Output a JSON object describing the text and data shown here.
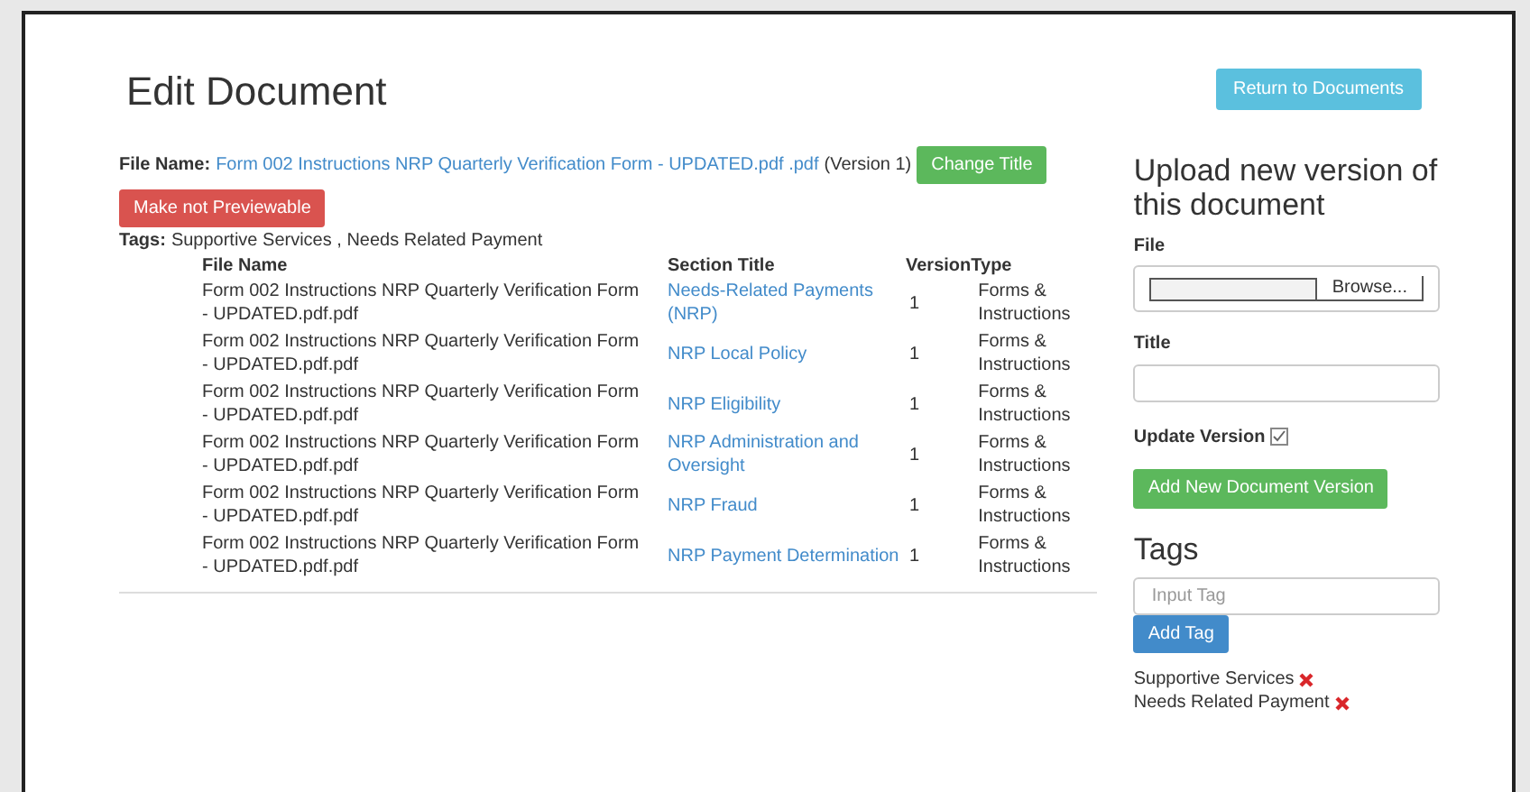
{
  "page_title": "Edit Document",
  "return_button": "Return to Documents",
  "file_name": {
    "label": "File Name:",
    "value": "Form 002 Instructions NRP Quarterly Verification Form - UPDATED.pdf .pdf",
    "version": "(Version 1)",
    "change_button": "Change Title"
  },
  "preview_button": "Make not Previewable",
  "tags_line": {
    "label": "Tags:",
    "value": "Supportive Services , Needs Related Payment"
  },
  "table": {
    "columns": [
      "File Name",
      "Section Title",
      "Version",
      "Type"
    ],
    "rows": [
      {
        "file_name": "Form 002 Instructions NRP Quarterly Verification Form - UPDATED.pdf.pdf",
        "section_title": "Needs-Related Payments (NRP)",
        "version": "1",
        "type": "Forms & Instructions"
      },
      {
        "file_name": "Form 002 Instructions NRP Quarterly Verification Form - UPDATED.pdf.pdf",
        "section_title": "NRP Local Policy",
        "version": "1",
        "type": "Forms & Instructions"
      },
      {
        "file_name": "Form 002 Instructions NRP Quarterly Verification Form - UPDATED.pdf.pdf",
        "section_title": "NRP Eligibility",
        "version": "1",
        "type": "Forms & Instructions"
      },
      {
        "file_name": "Form 002 Instructions NRP Quarterly Verification Form - UPDATED.pdf.pdf",
        "section_title": "NRP Administration and Oversight",
        "version": "1",
        "type": "Forms & Instructions"
      },
      {
        "file_name": "Form 002 Instructions NRP Quarterly Verification Form - UPDATED.pdf.pdf",
        "section_title": "NRP Fraud",
        "version": "1",
        "type": "Forms & Instructions"
      },
      {
        "file_name": "Form 002 Instructions NRP Quarterly Verification Form - UPDATED.pdf.pdf",
        "section_title": "NRP Payment Determination",
        "version": "1",
        "type": "Forms & Instructions"
      }
    ]
  },
  "upload": {
    "heading": "Upload new version of this document",
    "file_label": "File",
    "browse_button": "Browse...",
    "title_label": "Title",
    "update_version": {
      "label": "Update Version",
      "checked": true
    },
    "submit_button": "Add New Document Version"
  },
  "tags": {
    "heading": "Tags",
    "placeholder": "Input Tag",
    "add_button": "Add Tag",
    "items": [
      "Supportive Services",
      "Needs Related Payment"
    ]
  }
}
